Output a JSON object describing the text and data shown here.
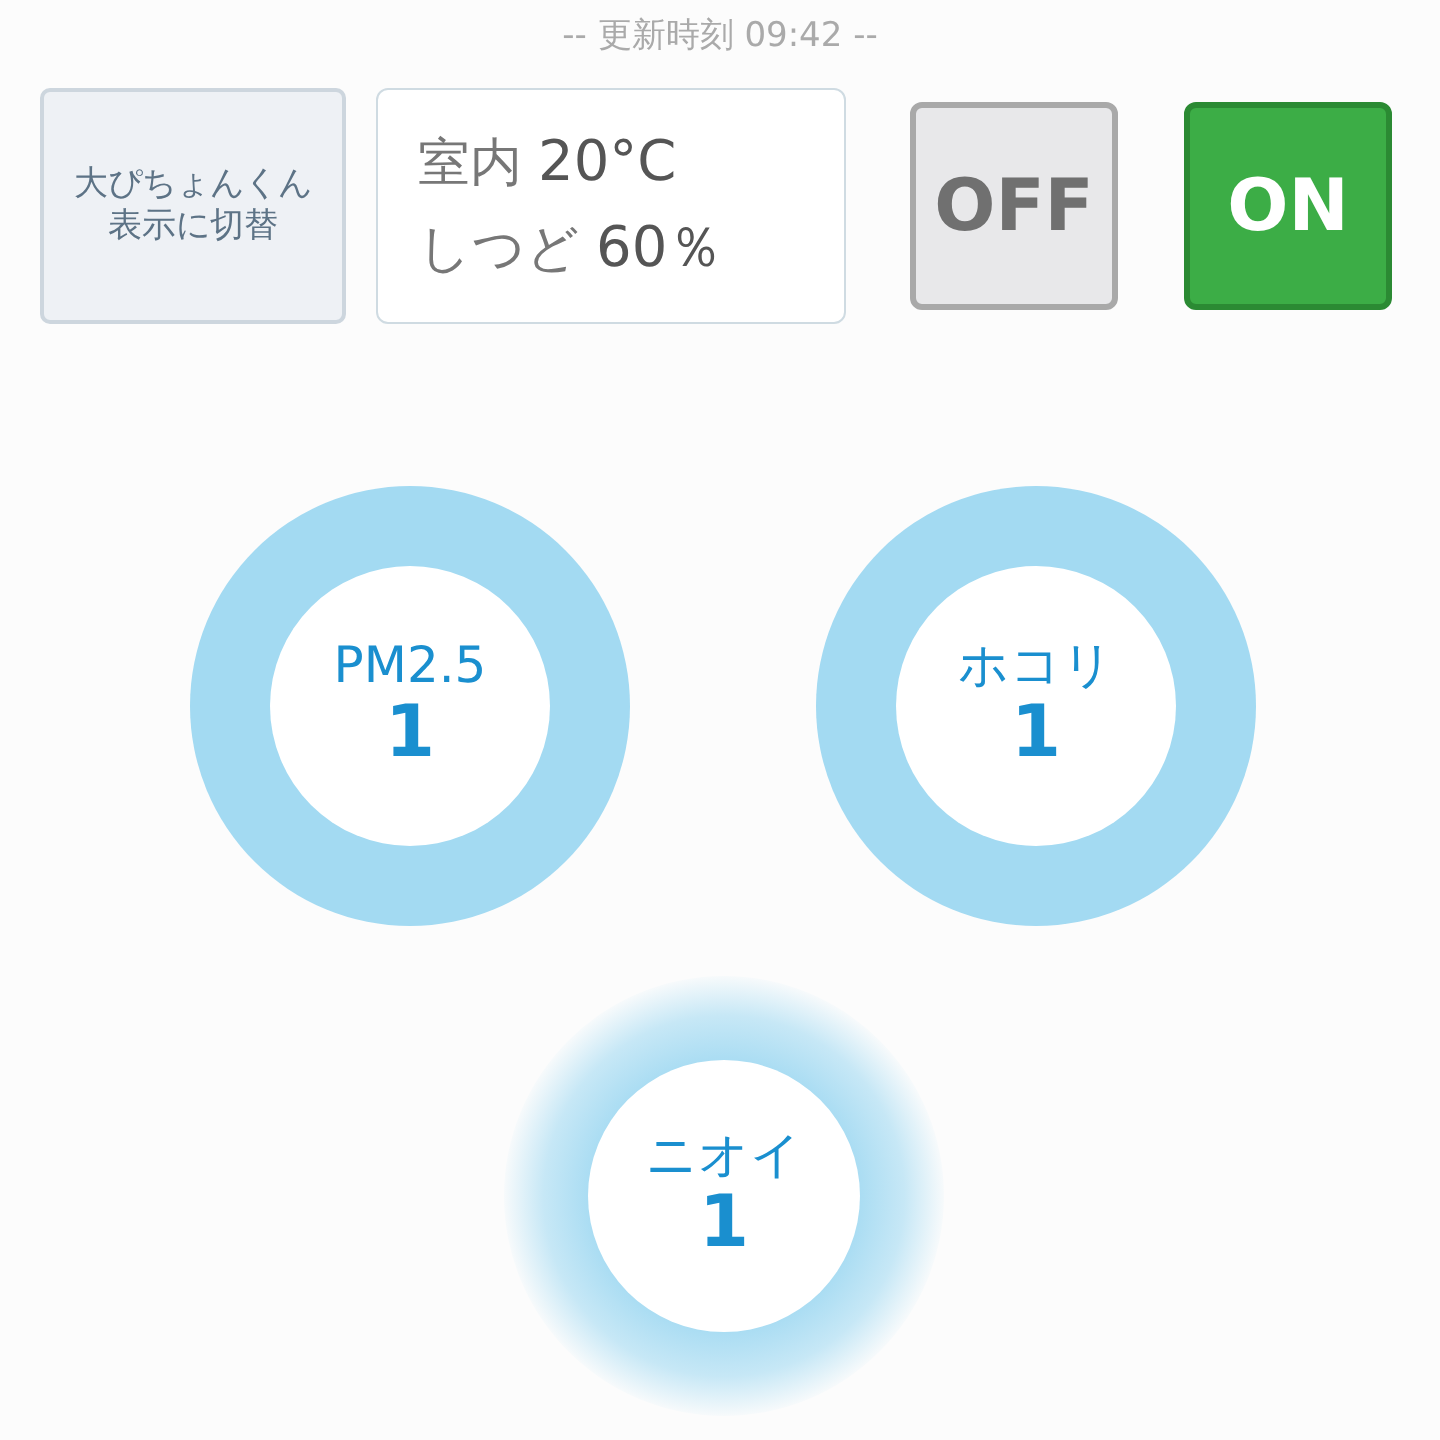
{
  "header": {
    "updated": "-- 更新時刻 09:42 --"
  },
  "switch_button": {
    "label": "大ぴちょんくん表示に切替"
  },
  "climate": [
    {
      "label": "室内",
      "value": "20°C"
    },
    {
      "label": "しつど",
      "value": "60％"
    }
  ],
  "power_buttons": [
    {
      "label": "OFF",
      "selected": false
    },
    {
      "label": "ON",
      "selected": true
    }
  ],
  "sensors": [
    {
      "name": "PM2.5",
      "value": "1",
      "kind": "ring"
    },
    {
      "name": "ホコリ",
      "value": "1",
      "kind": "ring"
    },
    {
      "name": "ニオイ",
      "value": "1",
      "kind": "glow"
    }
  ]
}
